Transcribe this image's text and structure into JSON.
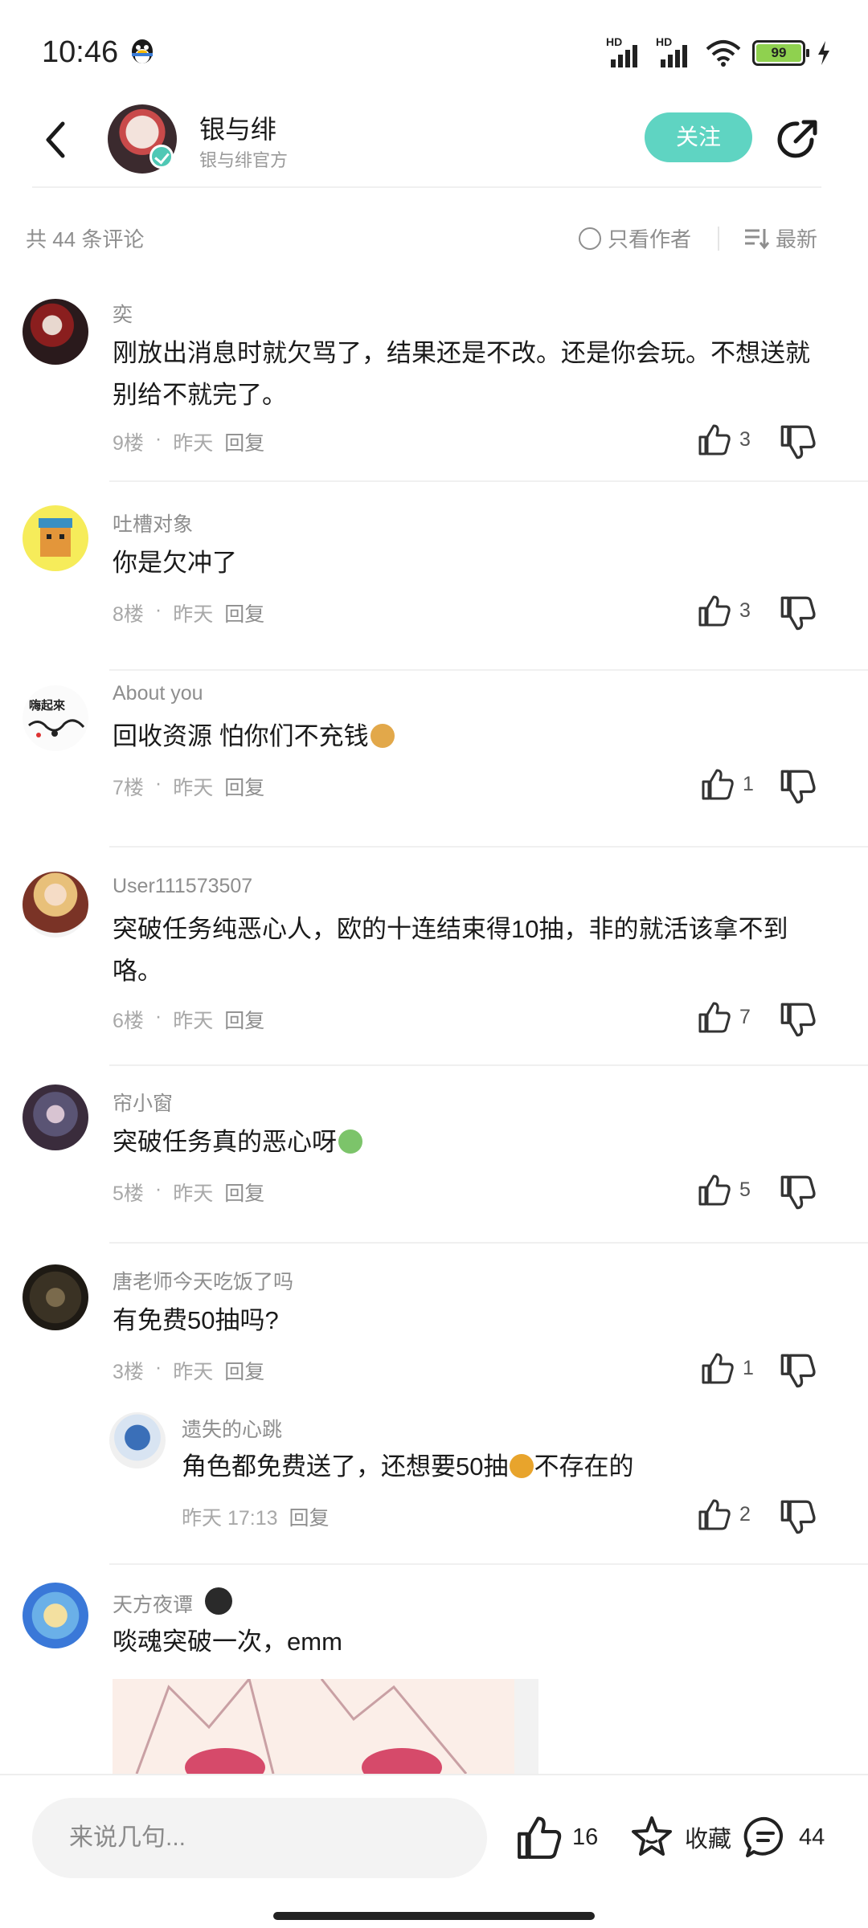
{
  "status_bar": {
    "time": "10:46",
    "battery": "99",
    "net1": "HD",
    "net2": "HD"
  },
  "header": {
    "name": "银与绯",
    "subtitle": "银与绯官方",
    "follow_label": "关注"
  },
  "comments_bar": {
    "total": "共 44 条评论",
    "author_only": "只看作者",
    "sort_label": "最新"
  },
  "comments": [
    {
      "user": "奕",
      "text": "刚放出消息时就欠骂了，结果还是不改。还是你会玩。不想送就别给不就完了。",
      "floor": "9楼",
      "dot": "·",
      "time": "昨天",
      "reply": "回复",
      "likes": "3"
    },
    {
      "user": "吐槽对象",
      "text": "你是欠冲了",
      "floor": "8楼",
      "dot": "·",
      "time": "昨天",
      "reply": "回复",
      "likes": "3"
    },
    {
      "user": "About you",
      "text": "回收资源  怕你们不充钱",
      "floor": "7楼",
      "dot": "·",
      "time": "昨天",
      "reply": "回复",
      "likes": "1"
    },
    {
      "user": "User111573507",
      "text": "突破任务纯恶心人，欧的十连结束得10抽，非的就活该拿不到咯。",
      "floor": "6楼",
      "dot": "·",
      "time": "昨天",
      "reply": "回复",
      "likes": "7"
    },
    {
      "user": "帘小窗",
      "text": "突破任务真的恶心呀",
      "floor": "5楼",
      "dot": "·",
      "time": "昨天",
      "reply": "回复",
      "likes": "5"
    },
    {
      "user": "唐老师今天吃饭了吗",
      "text": "有免费50抽吗?",
      "floor": "3楼",
      "dot": "·",
      "time": "昨天",
      "reply": "回复",
      "likes": "1"
    },
    {
      "user": "天方夜谭",
      "text": "啖魂突破一次，emm"
    }
  ],
  "sub_reply": {
    "user": "遗失的心跳",
    "text_a": "角色都免费送了，还想要50抽",
    "text_b": "不存在的",
    "time": "昨天 17:13",
    "reply": "回复",
    "likes": "2"
  },
  "avatar_text": {
    "about_you": "嗨起來"
  },
  "bottom_bar": {
    "placeholder": "来说几句...",
    "likes": "16",
    "favorite_label": "收藏",
    "comments": "44"
  },
  "colors": {
    "accent": "#5fd4c2",
    "battery": "#8fd14f"
  }
}
